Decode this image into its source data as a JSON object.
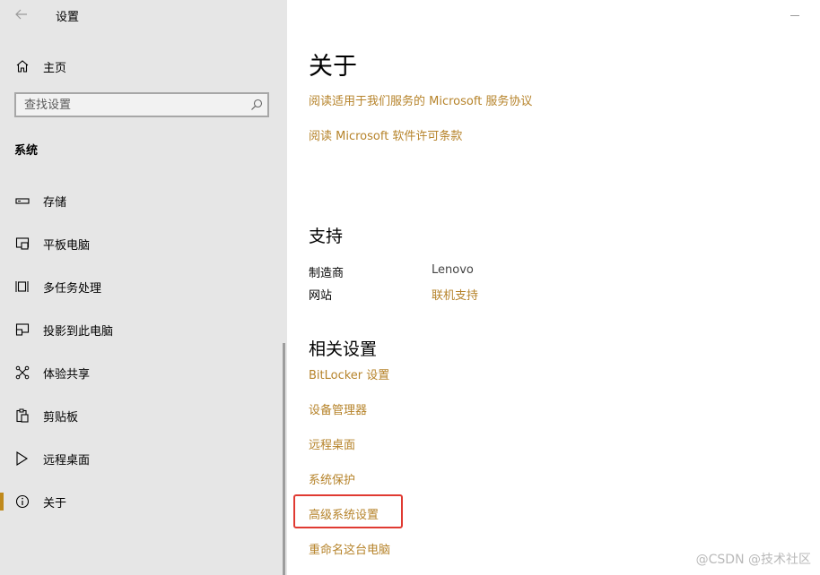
{
  "window": {
    "title": "设置"
  },
  "sidebar": {
    "home_label": "主页",
    "search": {
      "placeholder": "查找设置"
    },
    "section_heading": "系统",
    "items": [
      {
        "label": "存储",
        "icon": "storage-icon"
      },
      {
        "label": "平板电脑",
        "icon": "tablet-icon"
      },
      {
        "label": "多任务处理",
        "icon": "multitasking-icon"
      },
      {
        "label": "投影到此电脑",
        "icon": "projection-icon"
      },
      {
        "label": "体验共享",
        "icon": "shared-experiences-icon"
      },
      {
        "label": "剪贴板",
        "icon": "clipboard-icon"
      },
      {
        "label": "远程桌面",
        "icon": "remote-desktop-icon"
      },
      {
        "label": "关于",
        "icon": "info-icon",
        "selected": true
      }
    ]
  },
  "main": {
    "title": "关于",
    "top_links": [
      "阅读适用于我们服务的 Microsoft 服务协议",
      "阅读 Microsoft 软件许可条款"
    ],
    "support": {
      "title": "支持",
      "rows": [
        {
          "label": "制造商",
          "value": "Lenovo"
        },
        {
          "label": "网站",
          "value": "联机支持"
        }
      ]
    },
    "related": {
      "title": "相关设置",
      "links": [
        "BitLocker 设置",
        "设备管理器",
        "远程桌面",
        "系统保护",
        "高级系统设置",
        "重命名这台电脑"
      ]
    }
  },
  "watermark": "@CSDN @技术社区",
  "colors": {
    "accent": "#c08a1c",
    "link": "#b6832a",
    "sidebar_bg": "#e6e6e6",
    "highlight": "#e03a32"
  }
}
